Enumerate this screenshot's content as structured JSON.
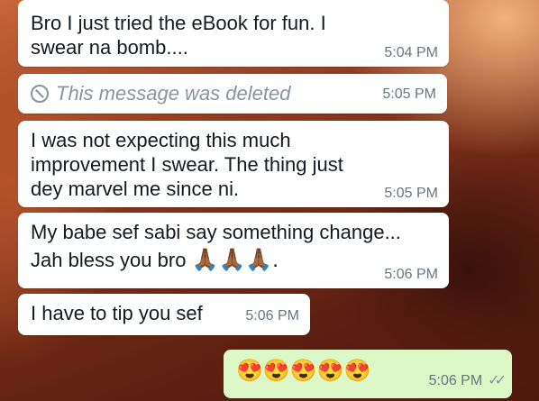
{
  "messages": [
    {
      "text": "Bro I just tried the eBook for fun. I swear na bomb....",
      "time": "5:04 PM"
    },
    {
      "text": "This message was deleted",
      "time": "5:05 PM",
      "deleted": true
    },
    {
      "text": "I was not expecting this much improvement I swear. The thing just dey marvel me since ni.",
      "time": "5:05 PM"
    },
    {
      "line1": "My babe sef sabi say something change...",
      "line2": "Jah bless you bro",
      "emoji": "🙏🏾🙏🏾🙏🏾.",
      "time": "5:06 PM"
    },
    {
      "text": "I have to tip you sef",
      "time": "5:06 PM"
    },
    {
      "emoji": "😍😍😍😍😍",
      "time": "5:06 PM",
      "status": "read-ticks-icon"
    }
  ]
}
